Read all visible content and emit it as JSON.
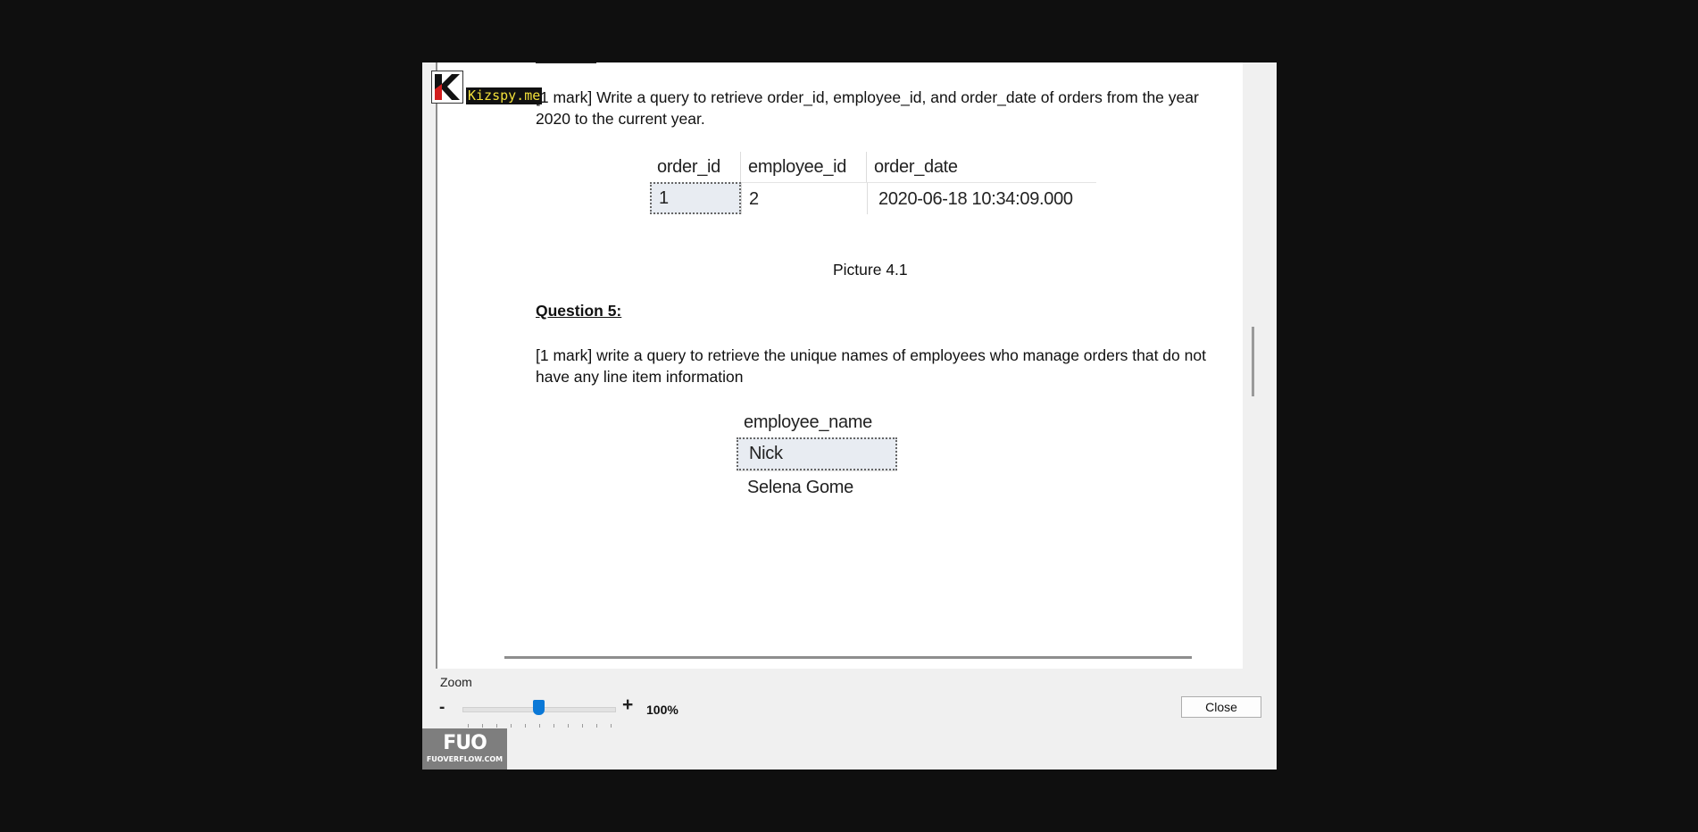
{
  "watermark": {
    "text": "Kizspy.me"
  },
  "document": {
    "q4_text_prefix": "[1 mark] Write a query to retrieve order_id, employee_id, and order_date of orders from the year 2020 to the current year.",
    "table1": {
      "headers": [
        "order_id",
        "employee_id",
        "order_date"
      ],
      "rows": [
        [
          "1",
          "2",
          "2020-06-18 10:34:09.000"
        ]
      ]
    },
    "caption": "Picture 4.1",
    "q5_heading": "Question 5:",
    "q5_text": "[1 mark]  write a query to retrieve the unique  names of employees who manage orders that do not have any line item information",
    "table2": {
      "header": "employee_name",
      "rows": [
        "Nick",
        "Selena Gome"
      ]
    }
  },
  "footer": {
    "zoom_label": "Zoom",
    "zoom_minus": "-",
    "zoom_plus": "+",
    "zoom_value": "100%",
    "zoom_level_percent": 100,
    "close_label": "Close"
  },
  "logo": {
    "text": "FUO",
    "subtext": "FUOVERFLOW.COM"
  }
}
